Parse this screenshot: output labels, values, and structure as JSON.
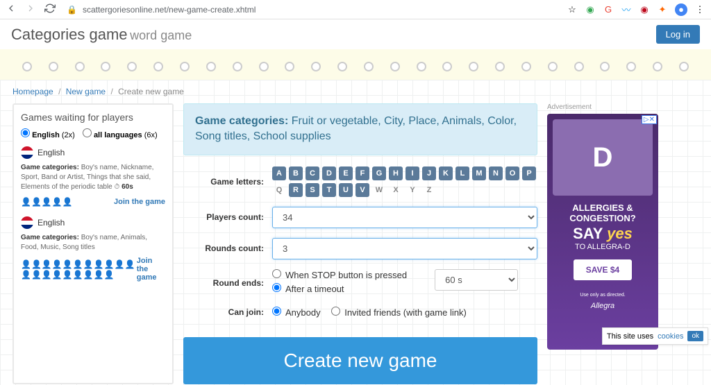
{
  "browser": {
    "url": "scattergoriesonline.net/new-game-create.xhtml"
  },
  "header": {
    "title": "Categories game",
    "subtitle": "word game",
    "login_label": "Log in"
  },
  "breadcrumb": {
    "home": "Homepage",
    "new_game": "New game",
    "current": "Create new game"
  },
  "sidebar": {
    "title": "Games waiting for players",
    "filter_english_label": "English",
    "filter_english_count": "(2x)",
    "filter_all_label": "all languages",
    "filter_all_count": "(6x)",
    "items": [
      {
        "lang": "English",
        "cats_label": "Game categories:",
        "cats": "Boy's name, Nickname, Sport, Band or Artist, Things that she said, Elements of the periodic table",
        "timer_icon": "clock-icon",
        "timer": "60s",
        "players_green": 4,
        "players_red": 1,
        "join_label": "Join the game"
      },
      {
        "lang": "English",
        "cats_label": "Game categories:",
        "cats": "Boy's name, Animals, Food, Music, Song titles",
        "players_green": 2,
        "players_red": 18,
        "join_label": "Join the game"
      }
    ]
  },
  "main": {
    "banner_label": "Game categories:",
    "banner_cats": "Fruit or vegetable, City, Place, Animals, Color, Song titles, School supplies",
    "letters_label": "Game letters:",
    "letters": [
      {
        "l": "A",
        "on": true
      },
      {
        "l": "B",
        "on": true
      },
      {
        "l": "C",
        "on": true
      },
      {
        "l": "D",
        "on": true
      },
      {
        "l": "E",
        "on": true
      },
      {
        "l": "F",
        "on": true
      },
      {
        "l": "G",
        "on": true
      },
      {
        "l": "H",
        "on": true
      },
      {
        "l": "I",
        "on": true
      },
      {
        "l": "J",
        "on": true
      },
      {
        "l": "K",
        "on": true
      },
      {
        "l": "L",
        "on": true
      },
      {
        "l": "M",
        "on": true
      },
      {
        "l": "N",
        "on": true
      },
      {
        "l": "O",
        "on": true
      },
      {
        "l": "P",
        "on": true
      },
      {
        "l": "Q",
        "on": false
      },
      {
        "l": "R",
        "on": true
      },
      {
        "l": "S",
        "on": true
      },
      {
        "l": "T",
        "on": true
      },
      {
        "l": "U",
        "on": true
      },
      {
        "l": "V",
        "on": true
      },
      {
        "l": "W",
        "on": false
      },
      {
        "l": "X",
        "on": false
      },
      {
        "l": "Y",
        "on": false
      },
      {
        "l": "Z",
        "on": false
      }
    ],
    "players_label": "Players count:",
    "players_value": "34",
    "rounds_label": "Rounds count:",
    "rounds_value": "3",
    "round_ends_label": "Round ends:",
    "round_ends_opt1": "When STOP button is pressed",
    "round_ends_opt2": "After a timeout",
    "timeout_value": "60 s",
    "can_join_label": "Can join:",
    "can_join_opt1": "Anybody",
    "can_join_opt2": "Invited friends (with game link)",
    "create_label": "Create new game"
  },
  "ad": {
    "label": "Advertisement",
    "letter": "D",
    "line1": "ALLERGIES & CONGESTION?",
    "line2a": "SAY",
    "line2b": "yes",
    "line3": "TO ALLEGRA-D",
    "button": "SAVE $4",
    "disclaimer": "Use only as directed.",
    "logo": "Allegra"
  },
  "cookie": {
    "text": "This site uses",
    "link": "cookies",
    "ok": "ok"
  }
}
